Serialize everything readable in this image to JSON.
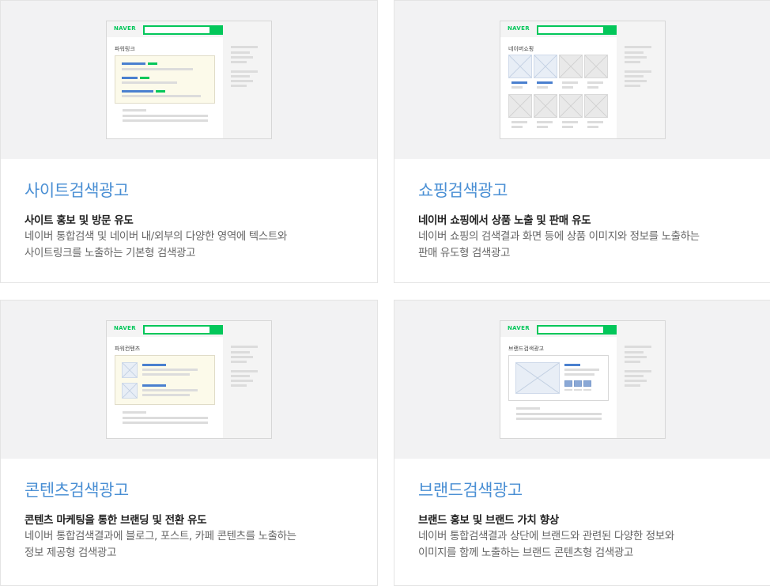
{
  "cards": [
    {
      "title": "사이트검색광고",
      "subtitle": "사이트 홍보 및 방문 유도",
      "desc": [
        "네이버 통합검색 및 네이버 내/외부의 다양한 영역에 텍스트와",
        "사이트링크를 노출하는 기본형 검색광고"
      ],
      "mock_logo": "NAVER",
      "mock_label": "파워링크"
    },
    {
      "title": "쇼핑검색광고",
      "subtitle": "네이버 쇼핑에서 상품 노출 및 판매 유도",
      "desc": [
        "네이버 쇼핑의 검색결과 화면 등에 상품 이미지와 정보를 노출하는",
        "판매 유도형 검색광고"
      ],
      "mock_logo": "NAVER",
      "mock_label": "네이버쇼핑"
    },
    {
      "title": "콘텐츠검색광고",
      "subtitle": "콘텐츠 마케팅을 통한 브랜딩 및 전환 유도",
      "desc": [
        "네이버 통합검색결과에 블로그, 포스트, 카페 콘텐츠를 노출하는",
        "정보 제공형 검색광고"
      ],
      "mock_logo": "NAVER",
      "mock_label": "파워컨텐츠"
    },
    {
      "title": "브랜드검색광고",
      "subtitle": "브랜드 홍보 및 브랜드 가치 향상",
      "desc": [
        "네이버 통합검색결과 상단에 브랜드와 관련된 다양한 정보와",
        "이미지를 함께 노출하는 브랜드 콘텐츠형 검색광고"
      ],
      "mock_logo": "NAVER",
      "mock_label": "브랜드검색광고"
    }
  ],
  "colors": {
    "accent": "#4a8fd4",
    "naver_green": "#03c75a",
    "mock_blue": "#4a80cf"
  }
}
